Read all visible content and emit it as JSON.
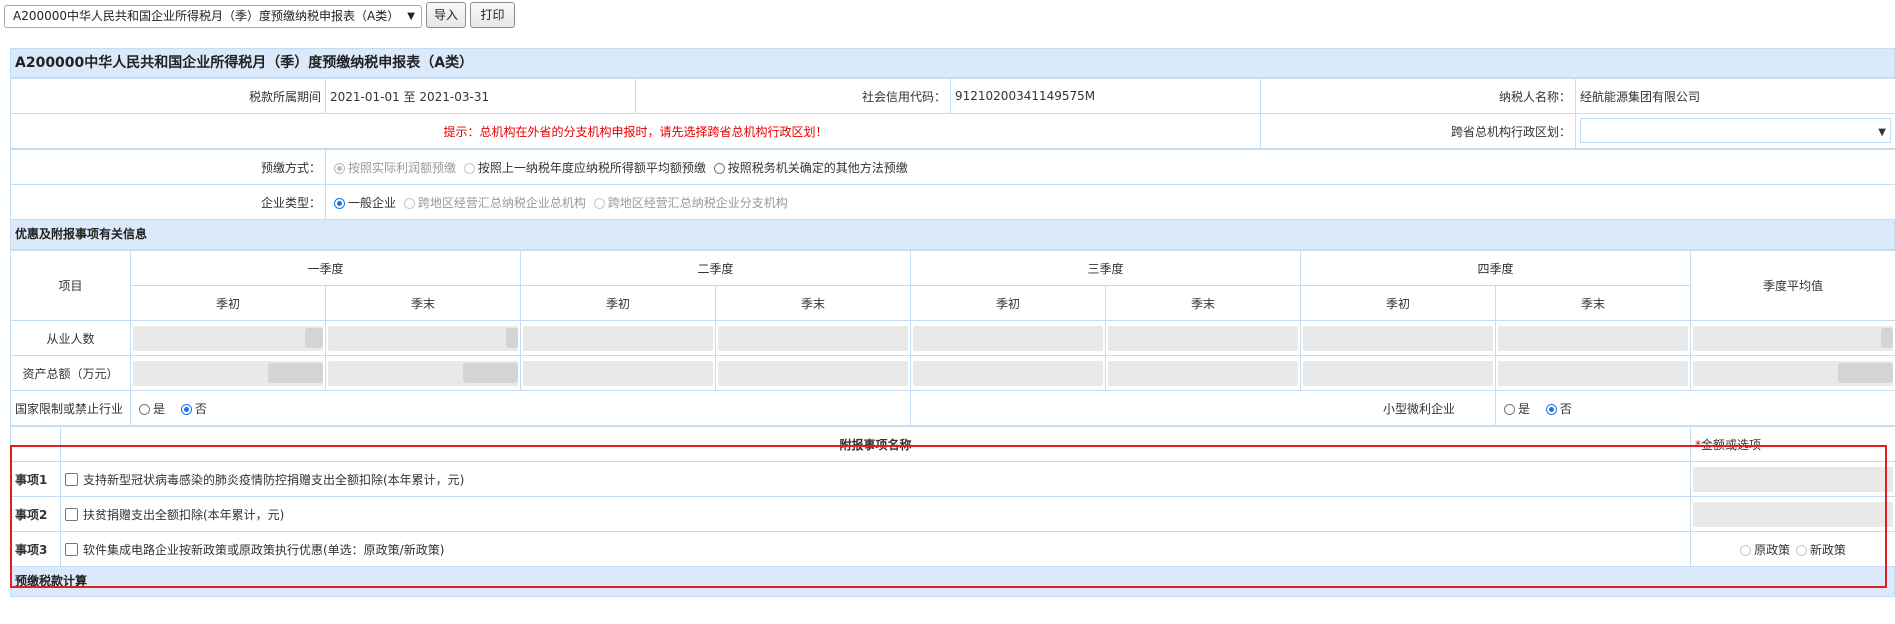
{
  "toolbar": {
    "form_select_value": "A200000中华人民共和国企业所得税月（季）度预缴纳税申报表（A类）",
    "import_label": "导入",
    "print_label": "打印"
  },
  "form": {
    "title": "A200000中华人民共和国企业所得税月（季）度预缴纳税申报表（A类）",
    "period_label": "税款所属期间",
    "period_value": "2021-01-01 至 2021-03-31",
    "credit_code_label": "社会信用代码：",
    "credit_code_value": "91210200341149575M",
    "taxpayer_label": "纳税人名称：",
    "taxpayer_value": "经航能源集团有限公司",
    "hint": "提示：总机构在外省的分支机构申报时，请先选择跨省总机构行政区划！",
    "region_label": "跨省总机构行政区划：",
    "region_value": "",
    "prepay_label": "预缴方式：",
    "prepay_options": [
      "按照实际利润额预缴",
      "按照上一纳税年度应纳税所得额平均额预缴",
      "按照税务机关确定的其他方法预缴"
    ],
    "type_label": "企业类型：",
    "type_options": [
      "一般企业",
      "跨地区经营汇总纳税企业总机构",
      "跨地区经营汇总纳税企业分支机构"
    ]
  },
  "benefits": {
    "section_title": "优惠及附报事项有关信息",
    "item_header": "项目",
    "quarters": [
      "一季度",
      "二季度",
      "三季度",
      "四季度"
    ],
    "sub_begin": "季初",
    "sub_end": "季末",
    "avg_header": "季度平均值",
    "row_employees": "从业人数",
    "row_assets": "资产总额（万元）",
    "restricted_label": "国家限制或禁止行业",
    "small_label": "小型微利企业",
    "yes": "是",
    "no": "否"
  },
  "attached": {
    "name_header": "附报事项名称",
    "amount_required_mark": "*",
    "amount_header": "金额或选项",
    "items": [
      {
        "label": "事项1",
        "text": "支持新型冠状病毒感染的肺炎疫情防控捐赠支出全额扣除(本年累计，元)"
      },
      {
        "label": "事项2",
        "text": "扶贫捐赠支出全额扣除(本年累计，元)"
      },
      {
        "label": "事项3",
        "text": "软件集成电路企业按新政策或原政策执行优惠(单选：原政策/新政策)"
      }
    ],
    "opt_old": "原政策",
    "opt_new": "新政策"
  },
  "calc": {
    "section_title": "预缴税款计算"
  },
  "colors": {
    "header_bg": "#dbeafa",
    "border": "#c6dcf0",
    "warn": "#e60000",
    "highlight_box": "#e02020",
    "radio_checked": "#1a73e8"
  }
}
